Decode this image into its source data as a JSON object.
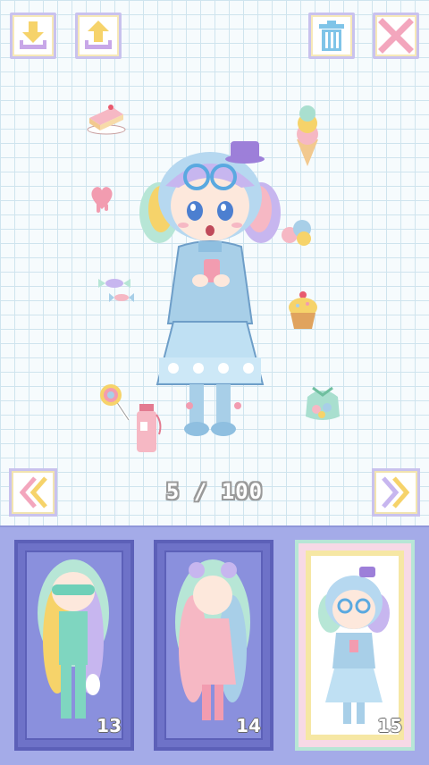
{
  "toolbar": {
    "import_icon": "tray-arrow-down-icon",
    "export_icon": "tray-arrow-up-icon",
    "delete_icon": "trash-icon",
    "close_icon": "close-x-icon"
  },
  "navigation": {
    "prev_icon": "double-chevron-left-icon",
    "next_icon": "double-chevron-right-icon",
    "counter": "5 / 100"
  },
  "stickers": [
    "cake-slice",
    "heart-drip",
    "wrapped-candy",
    "lollipop",
    "bottle",
    "ice-cream-cone",
    "gumballs",
    "cupcake",
    "candy-bag"
  ],
  "slots": [
    {
      "number": "13",
      "selected": false
    },
    {
      "number": "14",
      "selected": false
    },
    {
      "number": "15",
      "selected": true
    }
  ],
  "colors": {
    "grid_background": "#f6fbfd",
    "panel": "#a4abe8",
    "slot_frame": "#6e72c8",
    "button_border": "#c9c2ee",
    "accent_pink": "#f5b6c8",
    "accent_blue": "#a8cfe8"
  }
}
